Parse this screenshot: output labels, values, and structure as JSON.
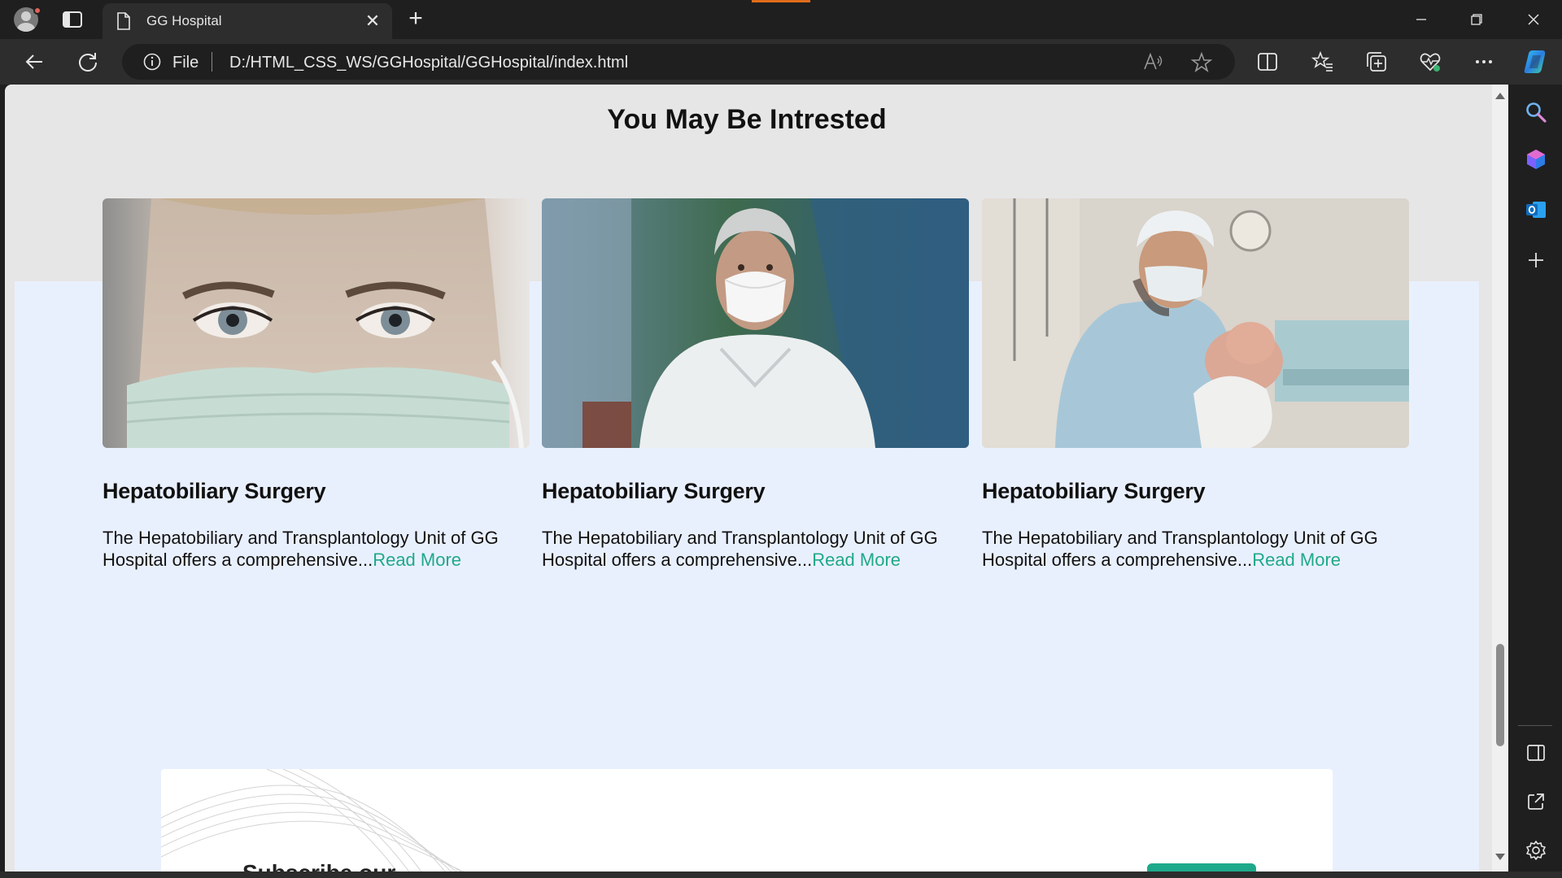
{
  "browser": {
    "tab_title": "GG Hospital",
    "address_scheme": "File",
    "address_url": "D:/HTML_CSS_WS/GGHospital/GGHospital/index.html",
    "accent_color": "#e06c1b"
  },
  "page": {
    "section_title": "You May Be Intrested",
    "cards": [
      {
        "title": "Hepatobiliary Surgery",
        "text": "The Hepatobiliary and Transplantology Unit of GG Hospital offers a comprehensive...",
        "link": "Read More",
        "image": "nurse-face-mask-photo"
      },
      {
        "title": "Hepatobiliary Surgery",
        "text": "The Hepatobiliary and Transplantology Unit of GG Hospital offers a comprehensive...",
        "link": "Read More",
        "image": "man-face-mask-photo"
      },
      {
        "title": "Hepatobiliary Surgery",
        "text": "The Hepatobiliary and Transplantology Unit of GG Hospital offers a comprehensive...",
        "link": "Read More",
        "image": "doctor-holding-newborn-photo"
      }
    ],
    "subscribe_title": "Subscribe our",
    "link_color": "#1fa98b",
    "band_color": "#e9f0fd"
  }
}
